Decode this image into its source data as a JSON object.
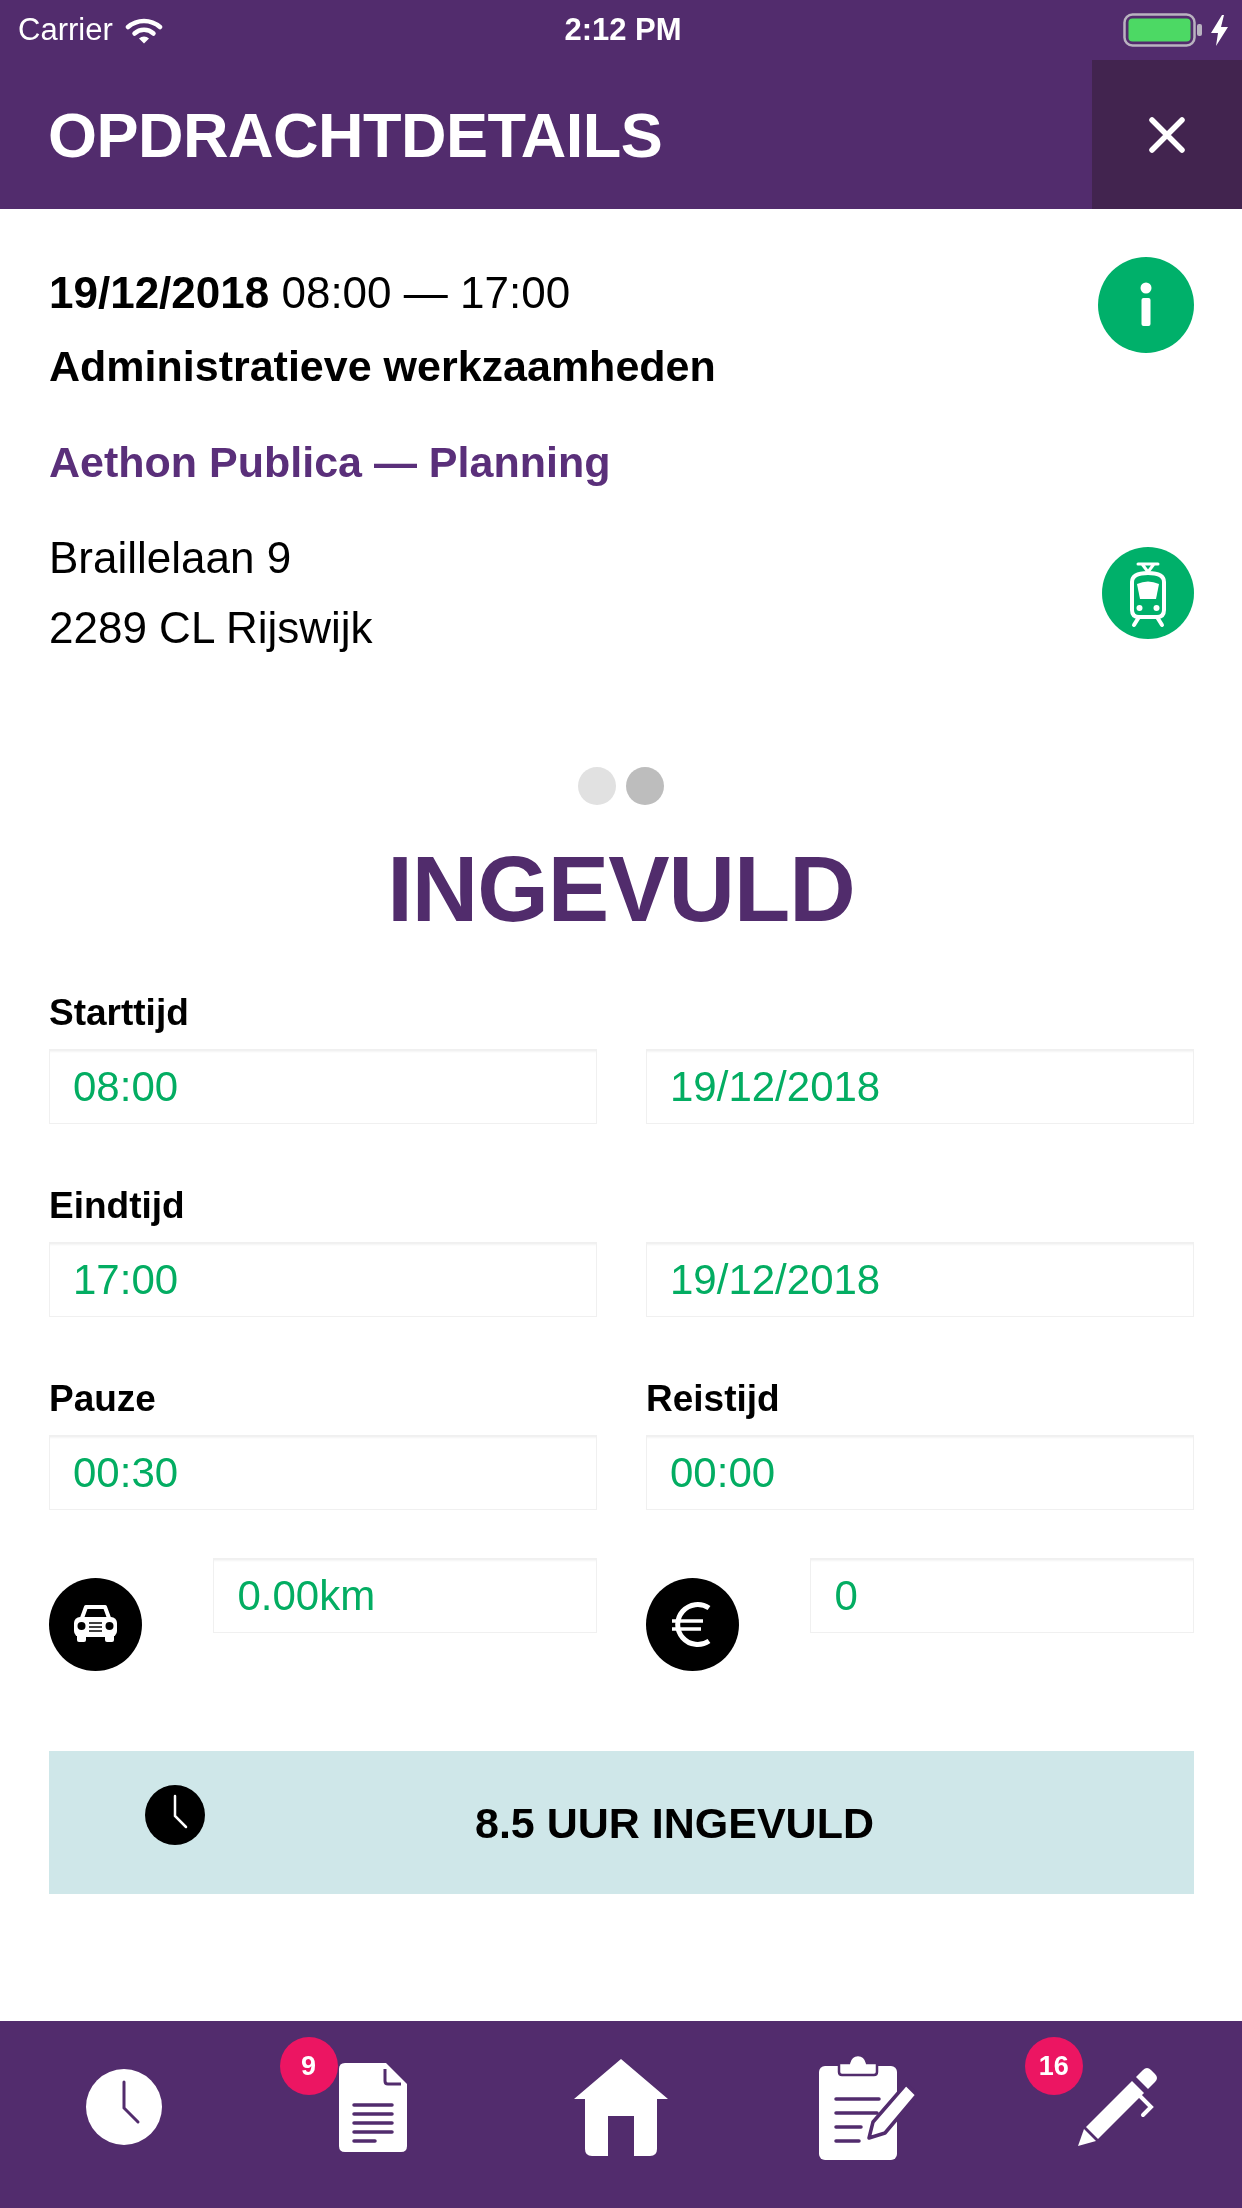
{
  "status_bar": {
    "carrier": "Carrier",
    "time": "2:12 PM"
  },
  "header": {
    "title": "OPDRACHTDETAILS"
  },
  "assignment": {
    "when": "**19/12/2018** 08:00 — 17:00",
    "task": "Administratieve werkzaamheden",
    "client": "Aethon Publica — Planning",
    "address": [
      "Braillelaan 9",
      "2289 CL Rijswijk"
    ]
  },
  "pages": [
    {
      "selected": false
    },
    {
      "selected": true
    }
  ],
  "status_title": "INGEVULD",
  "form": [
    {
      "fields": [
        {
          "kind": "plain",
          "label": "Starttijd",
          "value": "08:00"
        },
        {
          "kind": "plain",
          "value": "19/12/2018"
        }
      ]
    },
    {
      "fields": [
        {
          "kind": "plain",
          "label": "Eindtijd",
          "value": "17:00"
        },
        {
          "kind": "plain",
          "value": "19/12/2018"
        }
      ]
    },
    {
      "fields": [
        {
          "kind": "plain",
          "label": "Pauze",
          "value": "00:30"
        },
        {
          "kind": "plain",
          "label": "Reistijd",
          "value": "00:00"
        }
      ]
    },
    {
      "fields": [
        {
          "kind": "distance",
          "value": "0.00km"
        },
        {
          "kind": "amount",
          "value": "0"
        }
      ]
    }
  ],
  "summary": {
    "text": "8.5 UUR INGEVULD"
  },
  "tab_bar": [
    {
      "kind": "clock"
    },
    {
      "kind": "document",
      "badge": "9"
    },
    {
      "kind": "home"
    },
    {
      "kind": "clipboard"
    },
    {
      "kind": "pen",
      "badge": "16"
    }
  ]
}
